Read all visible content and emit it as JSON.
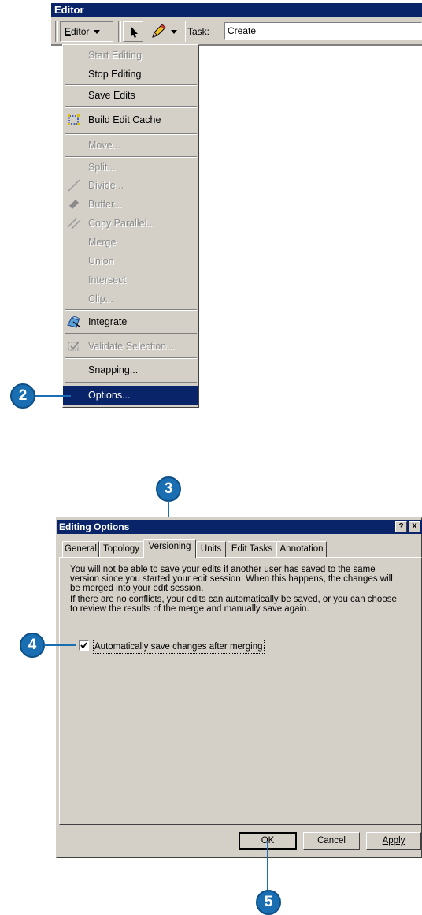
{
  "editor_toolbar": {
    "title": "Editor",
    "editor_menu_label": "Editor",
    "editor_menu_underline": "E",
    "task_label": "Task:",
    "task_value": "Create"
  },
  "editor_menu": {
    "items": [
      {
        "label": "Start Editing",
        "enabled": false
      },
      {
        "label": "Stop Editing",
        "enabled": true
      },
      {
        "label": "Save Edits",
        "enabled": true
      },
      {
        "label": "Build Edit Cache",
        "enabled": true,
        "icon": "edit-cache-icon"
      },
      {
        "label": "Move...",
        "enabled": false
      },
      {
        "label": "Split...",
        "enabled": false
      },
      {
        "label": "Divide...",
        "enabled": false,
        "icon": "divide-icon"
      },
      {
        "label": "Buffer...",
        "enabled": false,
        "icon": "buffer-icon"
      },
      {
        "label": "Copy Parallel...",
        "enabled": false,
        "icon": "copy-parallel-icon"
      },
      {
        "label": "Merge",
        "enabled": false
      },
      {
        "label": "Union",
        "enabled": false
      },
      {
        "label": "Intersect",
        "enabled": false
      },
      {
        "label": "Clip...",
        "enabled": false
      },
      {
        "label": "Integrate",
        "enabled": true,
        "icon": "integrate-icon"
      },
      {
        "label": "Validate Selection...",
        "enabled": false,
        "icon": "validate-icon"
      },
      {
        "label": "Snapping...",
        "enabled": true
      },
      {
        "label": "Options...",
        "enabled": true,
        "selected": true
      }
    ]
  },
  "callouts": {
    "options": "2",
    "versioning_tab": "3",
    "autosave": "4",
    "ok": "5"
  },
  "dialog": {
    "title": "Editing Options",
    "help_button": "?",
    "close_button": "X",
    "tabs": [
      {
        "label": "General",
        "active": false
      },
      {
        "label": "Topology",
        "active": false
      },
      {
        "label": "Versioning",
        "active": true
      },
      {
        "label": "Units",
        "active": false
      },
      {
        "label": "Edit Tasks",
        "active": false
      },
      {
        "label": "Annotation",
        "active": false
      }
    ],
    "paragraph1": [
      "You will not be able to save your edits if another user has saved to the same",
      "version since you started your edit session. When this happens, the changes will",
      "be merged into your edit session."
    ],
    "paragraph2": [
      "If there are no conflicts, your edits can automatically be saved, or you can choose",
      "to review the results of the merge and manually save again."
    ],
    "autosave_label": "Automatically save changes after merging",
    "autosave_checked": true,
    "ok_label": "OK",
    "cancel_label": "Cancel",
    "apply_label": "Apply"
  },
  "colors": {
    "titlebar": "#0a246a",
    "face": "#d4d0c8",
    "callout": "#1a6fb3"
  }
}
